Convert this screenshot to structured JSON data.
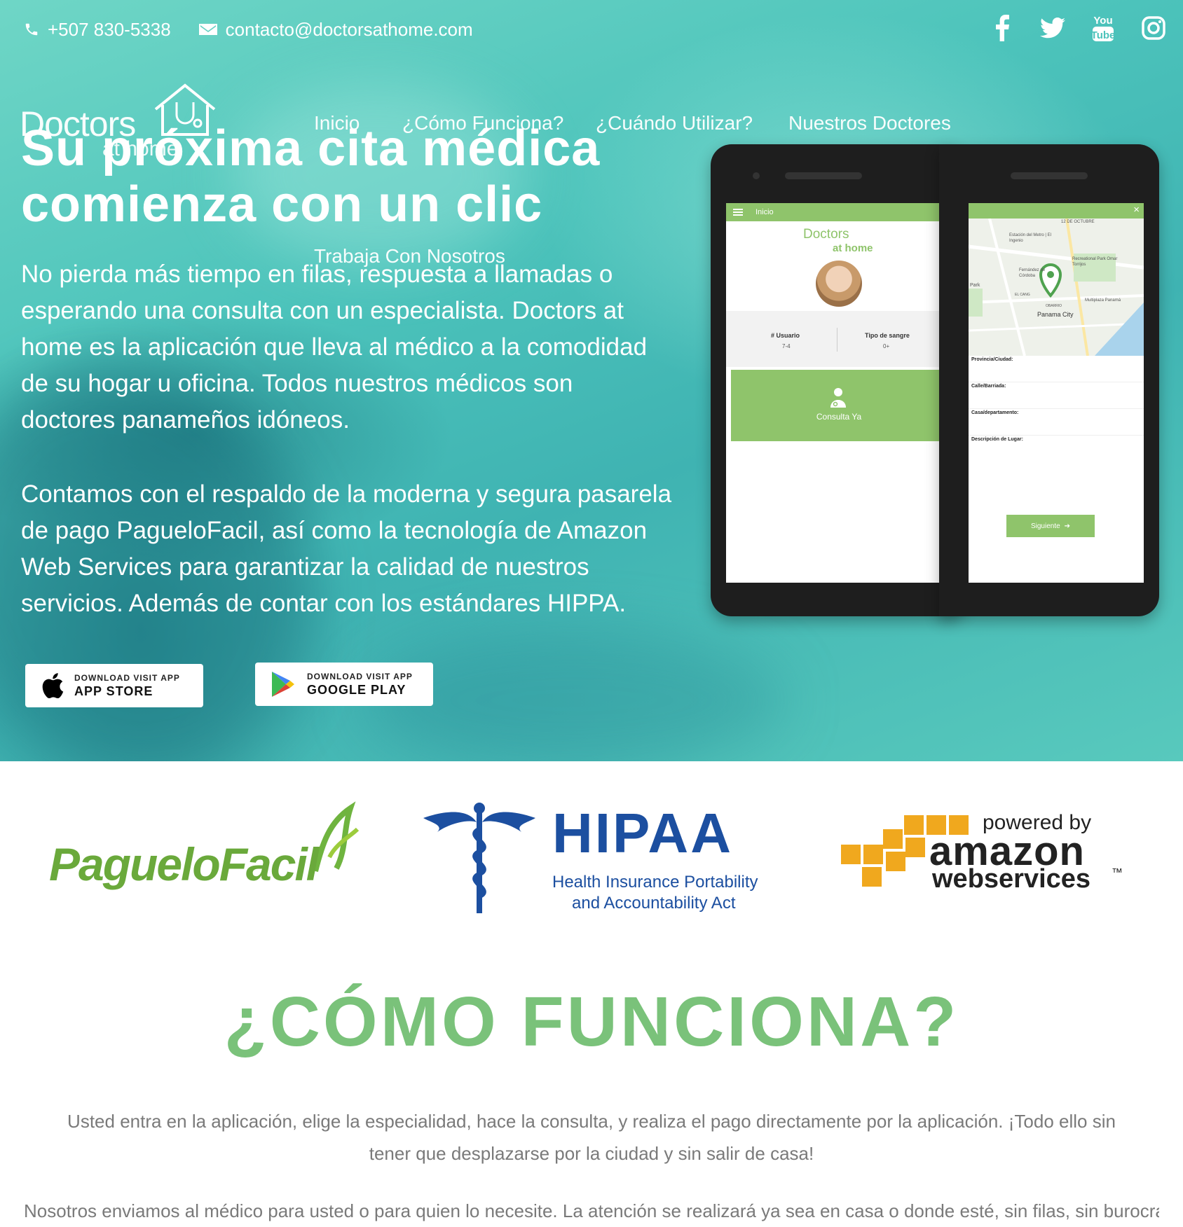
{
  "topbar": {
    "phone": "+507 830-5338",
    "email": "contacto@doctorsathome.com"
  },
  "social": [
    "facebook-icon",
    "twitter-icon",
    "youtube-icon",
    "instagram-icon"
  ],
  "logo": {
    "word": "Doctors",
    "sub": "at home"
  },
  "nav": {
    "inicio": "Inicio",
    "como": "¿Cómo Funciona?",
    "cuando": "¿Cuándo Utilizar?",
    "doctores": "Nuestros Doctores",
    "trabaja": "Trabaja Con Nosotros"
  },
  "hero": {
    "headline_line1": "Su próxima cita médica",
    "headline_line2": "comienza con un clic",
    "para1": "No pierda más tiempo en filas, respuesta a llamadas o esperando una consulta con un especialista. Doctors at home es la aplicación que lleva al médico a la comodidad de su hogar u oficina. Todos nuestros médicos son doctores panameños idóneos.",
    "para2": "Contamos con el respaldo de la moderna y segura pasarela de pago PagueloFacil, así como la tecnología de Amazon Web Services para garantizar la calidad de nuestros servicios. Además de contar con los estándares HIPPA."
  },
  "stores": {
    "apple_small": "DOWNLOAD VISIT APP",
    "apple_big": "APP STORE",
    "google_small": "DOWNLOAD VISIT APP",
    "google_big": "GOOGLE PLAY"
  },
  "phone_left": {
    "header": "Inicio",
    "logo_word": "Doctors",
    "logo_sub": "at home",
    "col1_label": "# Usuario",
    "col1_value": "7-4",
    "col2_label": "Tipo de sangre",
    "col2_value": "0+",
    "button": "Consulta Ya"
  },
  "phone_right": {
    "map_labels": [
      "12 DE OCTUBRE",
      "Estación del Metro | El Ingenio",
      "Recreational Park Omar Torrijos",
      "Fernández de Córdoba",
      "Multiplaza Panamá",
      "Panama City",
      "OBARRIO",
      "EL CANG",
      "Park"
    ],
    "fields": [
      "Provincia/Ciudad:",
      "Calle/Barriada:",
      "Casa/departamento:",
      "Descripción de Lugar:"
    ],
    "button": "Siguiente"
  },
  "partners": {
    "paguelo": "PagueloFacil",
    "hipaa": "HIPAA",
    "hipaa_sub1": "Health Insurance Portability",
    "hipaa_sub2": "and Accountability Act",
    "aws_powered": "powered by",
    "aws_amazon": "amazon",
    "aws_web": "webservices",
    "aws_tm": "™"
  },
  "how": {
    "title": "¿CÓMO FUNCIONA?",
    "text1": "Usted entra en la aplicación, elige la especialidad, hace la consulta, y realiza el pago directamente por la aplicación. ¡Todo ello sin tener que desplazarse por la ciudad y sin salir de casa!",
    "text2": "Nosotros enviamos al médico para usted o para quien lo necesite. La atención se realizará ya sea en casa o donde esté, sin filas, sin burocracia, sin"
  },
  "colors": {
    "accent_green": "#7ac27a",
    "app_green": "#8fc46b",
    "hipaa_blue": "#1c4fa0",
    "aws_orange": "#f0a81e"
  }
}
